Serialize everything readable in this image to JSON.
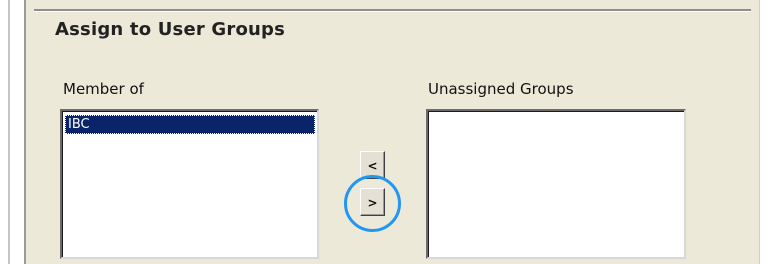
{
  "section": {
    "title": "Assign to User Groups"
  },
  "member_of": {
    "label": "Member of",
    "items": [
      {
        "label": "IBC",
        "selected": true
      }
    ]
  },
  "unassigned": {
    "label": "Unassigned Groups",
    "items": []
  },
  "buttons": {
    "move_left_label": "<",
    "move_right_label": ">"
  },
  "colors": {
    "panel_bg": "#ece9d8",
    "selection_bg": "#0a246a",
    "highlight_ring": "#2196f3"
  }
}
